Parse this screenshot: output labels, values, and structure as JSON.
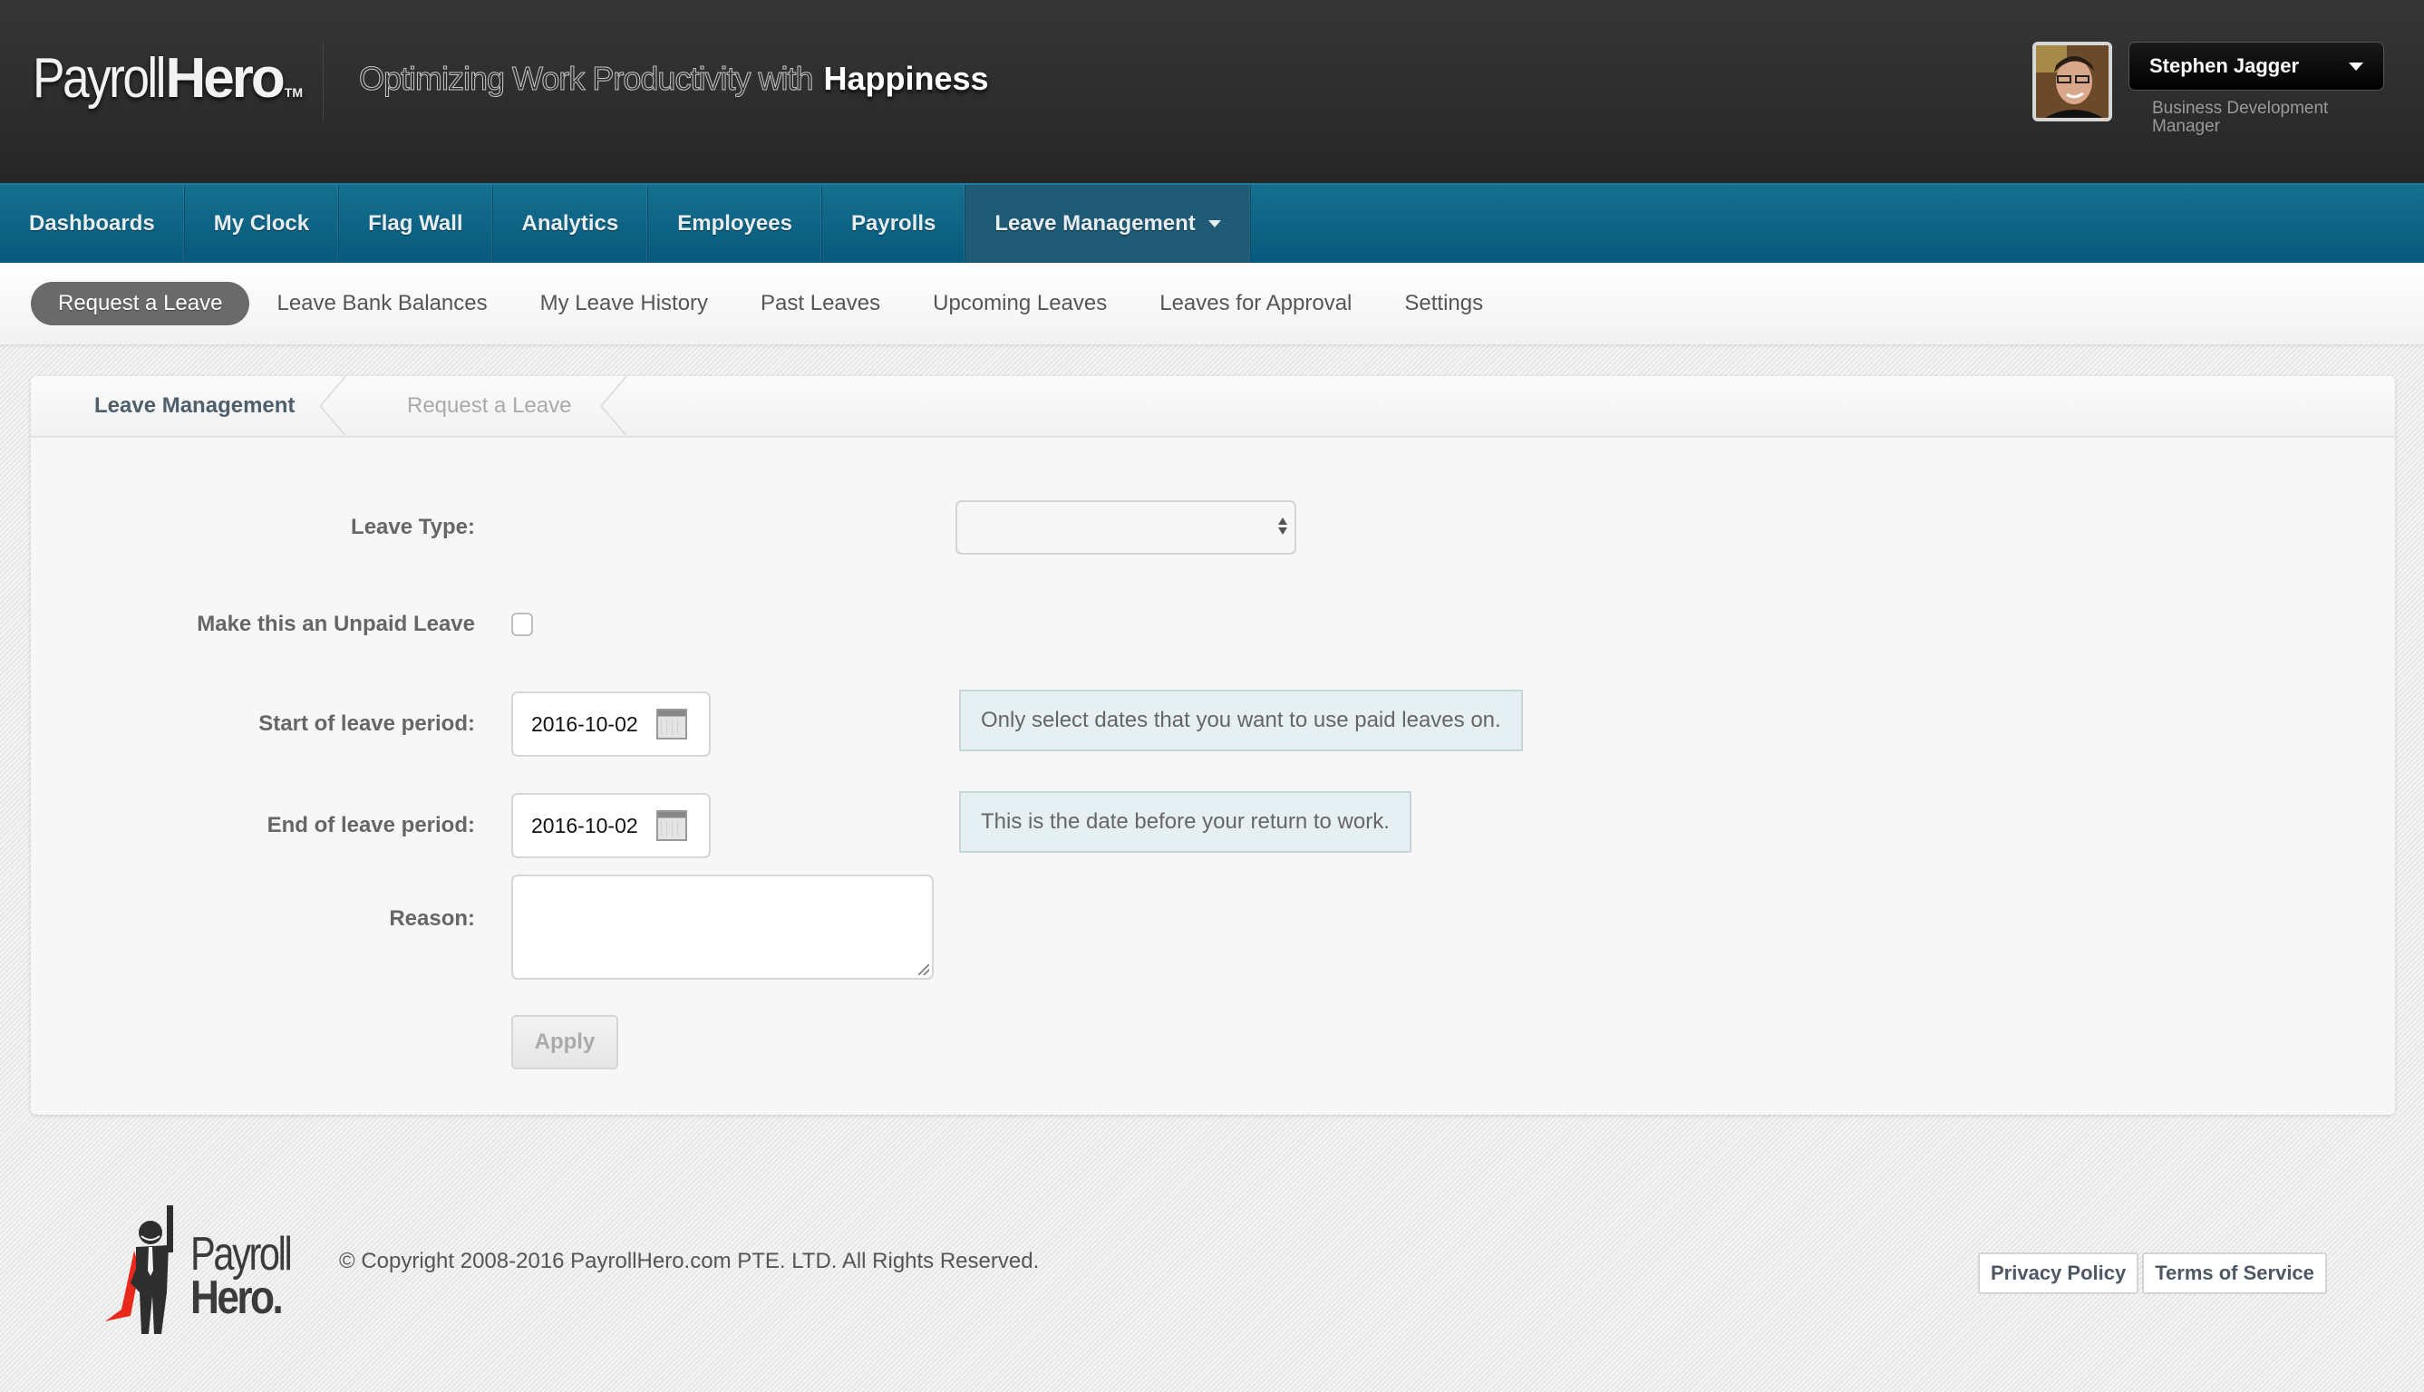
{
  "header": {
    "brand_light": "Payroll",
    "brand_bold": "Hero",
    "brand_tm": "TM",
    "tagline_light": "Optimizing Work Productivity with",
    "tagline_bold": "Happiness",
    "user": {
      "name": "Stephen Jagger",
      "role": "Business Development Manager",
      "avatar_icon": "user-photo"
    }
  },
  "main_nav": {
    "items": [
      {
        "label": "Dashboards"
      },
      {
        "label": "My Clock"
      },
      {
        "label": "Flag Wall"
      },
      {
        "label": "Analytics"
      },
      {
        "label": "Employees"
      },
      {
        "label": "Payrolls"
      },
      {
        "label": "Leave Management",
        "active": true,
        "has_dropdown": true
      }
    ]
  },
  "sub_nav": {
    "tabs": [
      {
        "label": "Request a Leave",
        "active": true
      },
      {
        "label": "Leave Bank Balances"
      },
      {
        "label": "My Leave History"
      },
      {
        "label": "Past Leaves"
      },
      {
        "label": "Upcoming Leaves"
      },
      {
        "label": "Leaves for Approval"
      },
      {
        "label": "Settings"
      }
    ]
  },
  "breadcrumb": {
    "items": [
      "Leave Management",
      "Request a Leave"
    ]
  },
  "form": {
    "leave_type": {
      "label": "Leave Type:",
      "value": ""
    },
    "unpaid": {
      "label": "Make this an Unpaid Leave",
      "checked": false
    },
    "start_date": {
      "label": "Start of leave period:",
      "value": "2016-10-02",
      "hint": "Only select dates that you want to use paid leaves on."
    },
    "end_date": {
      "label": "End of leave period:",
      "value": "2016-10-02",
      "hint": "This is the date before your return to work."
    },
    "reason": {
      "label": "Reason:",
      "value": ""
    },
    "apply_label": "Apply"
  },
  "footer": {
    "logo_line1": "Payroll",
    "logo_line2": "Hero.",
    "copyright": "© Copyright 2008-2016 PayrollHero.com PTE. LTD. All Rights Reserved.",
    "links": [
      "Privacy Policy",
      "Terms of Service"
    ]
  },
  "colors": {
    "nav_bg": "#0b6386",
    "header_bg": "#2e2e2e",
    "subnav_active": "#6a6a6a",
    "hint_bg": "#e6eff1",
    "cape_red": "#e8281a"
  }
}
